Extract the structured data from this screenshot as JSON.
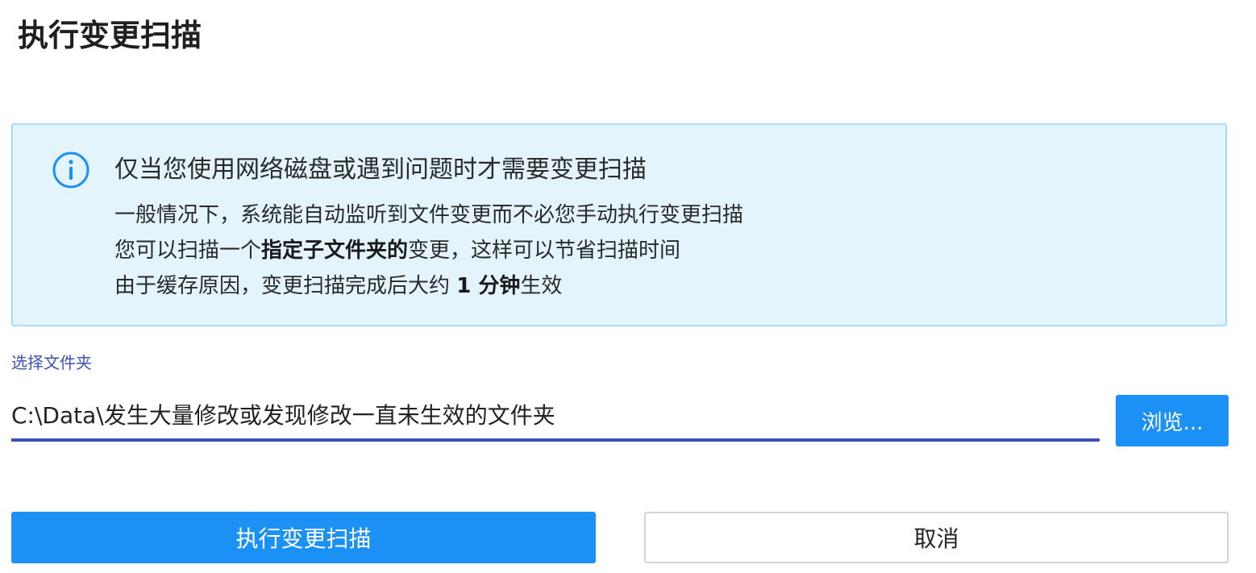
{
  "page": {
    "title": "执行变更扫描"
  },
  "info": {
    "icon": "info-circle-icon",
    "icon_color": "#1c91f5",
    "heading": "仅当您使用网络磁盘或遇到问题时才需要变更扫描",
    "line1": "一般情况下，系统能自动监听到文件变更而不必您手动执行变更扫描",
    "line2_prefix": "您可以扫描一个",
    "line2_bold": "指定子文件夹的",
    "line2_suffix": "变更，这样可以节省扫描时间",
    "line3_prefix": "由于缓存原因，变更扫描完成后大约 ",
    "line3_bold": "1 分钟",
    "line3_suffix": "生效"
  },
  "folder": {
    "label": "选择文件夹",
    "value": "C:\\Data\\发生大量修改或发现修改一直未生效的文件夹",
    "browse_label": "浏览..."
  },
  "actions": {
    "run_label": "执行变更扫描",
    "cancel_label": "取消"
  },
  "colors": {
    "accent": "#1c91f5",
    "input_underline": "#3f51b5",
    "info_background": "#e3f4fd",
    "info_border": "#a9dcf4"
  }
}
